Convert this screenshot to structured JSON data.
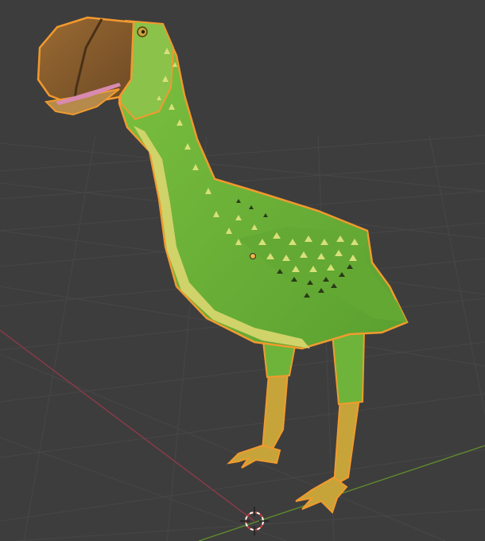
{
  "viewport": {
    "background": "#3d3d3d",
    "grid_color": "#4a4a4a",
    "x_axis_color": "#8e3a48",
    "y_axis_color": "#5f8a2c"
  },
  "object": {
    "selected": true,
    "outline_color": "#f29a2e",
    "body_color": "#6fb43a",
    "belly_color": "#cfd36a",
    "legs_color": "#c7a43a",
    "beak_color": "#8a5a2c",
    "tongue_color": "#d88ab0"
  },
  "icons": [
    "3d-cursor-icon",
    "object-origin-icon"
  ]
}
